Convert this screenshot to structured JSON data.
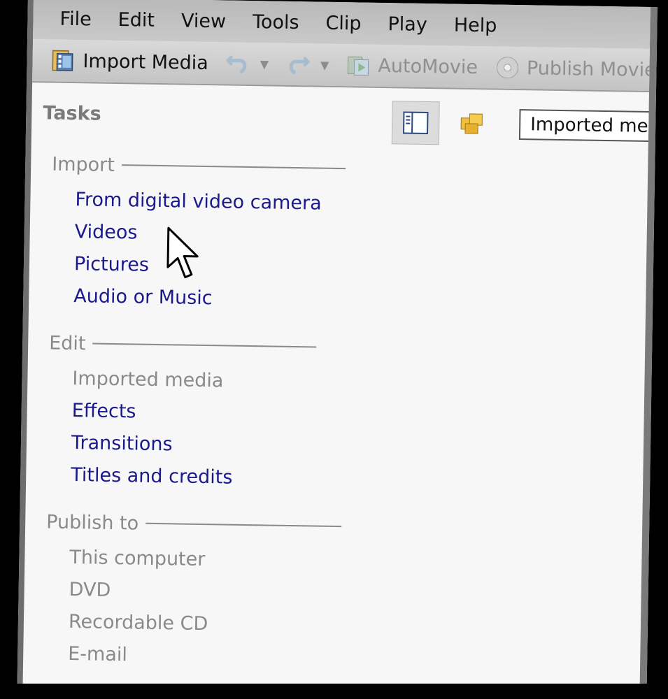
{
  "menu": [
    "File",
    "Edit",
    "View",
    "Tools",
    "Clip",
    "Play",
    "Help"
  ],
  "toolbar": {
    "import_media": "Import Media",
    "automovie": "AutoMovie",
    "publish_movie": "Publish Movie"
  },
  "tasks": {
    "title": "Tasks",
    "sections": [
      {
        "header": "Import",
        "items": [
          {
            "label": "From digital video camera",
            "enabled": true
          },
          {
            "label": "Videos",
            "enabled": true
          },
          {
            "label": "Pictures",
            "enabled": true
          },
          {
            "label": "Audio or Music",
            "enabled": true
          }
        ]
      },
      {
        "header": "Edit",
        "items": [
          {
            "label": "Imported media",
            "enabled": false
          },
          {
            "label": "Effects",
            "enabled": true
          },
          {
            "label": "Transitions",
            "enabled": true
          },
          {
            "label": "Titles and credits",
            "enabled": true
          }
        ]
      },
      {
        "header": "Publish to",
        "items": [
          {
            "label": "This computer",
            "enabled": false
          },
          {
            "label": "DVD",
            "enabled": false
          },
          {
            "label": "Recordable CD",
            "enabled": false
          },
          {
            "label": "E-mail",
            "enabled": false
          }
        ]
      }
    ]
  },
  "collection": {
    "selected": "Imported media"
  },
  "colors": {
    "link": "#1a1a8c",
    "disabled": "#8a8a8a",
    "toolbar": "#c9c9c9"
  }
}
